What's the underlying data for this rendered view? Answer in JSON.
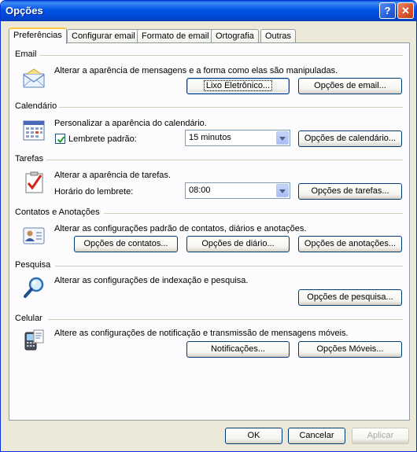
{
  "window": {
    "title": "Opções",
    "help_glyph": "?",
    "close_glyph": "✕"
  },
  "tabs": [
    {
      "label": "Preferências",
      "active": true
    },
    {
      "label": "Configurar email"
    },
    {
      "label": "Formato de email"
    },
    {
      "label": "Ortografia"
    },
    {
      "label": "Outras"
    }
  ],
  "email": {
    "section": "Email",
    "description": "Alterar a aparência de mensagens e a forma como elas são manipuladas.",
    "junk_button": "Lixo Eletrônico...",
    "options_button": "Opções de email..."
  },
  "calendar": {
    "section": "Calendário",
    "description": "Personalizar a aparência do calendário.",
    "reminder_label": "Lembrete padrão:",
    "reminder_checked": true,
    "reminder_value": "15 minutos",
    "options_button": "Opções de calendário..."
  },
  "tasks": {
    "section": "Tarefas",
    "description": "Alterar a aparência de tarefas.",
    "reminder_time_label": "Horário do lembrete:",
    "reminder_time_value": "08:00",
    "options_button": "Opções de tarefas..."
  },
  "contacts": {
    "section": "Contatos e Anotações",
    "description": "Alterar as configurações padrão de contatos, diários e anotações.",
    "contacts_button": "Opções de contatos...",
    "journal_button": "Opções de diário...",
    "notes_button": "Opções de anotações..."
  },
  "search": {
    "section": "Pesquisa",
    "description": "Alterar as configurações de indexação e pesquisa.",
    "options_button": "Opções de pesquisa..."
  },
  "mobile": {
    "section": "Celular",
    "description": "Altere as configurações de notificação e transmissão de mensagens móveis.",
    "notifications_button": "Notificações...",
    "mobile_button": "Opções Móveis..."
  },
  "footer": {
    "ok": "OK",
    "cancel": "Cancelar",
    "apply": "Aplicar",
    "apply_enabled": false
  },
  "colors": {
    "titlebar": "#0054e3",
    "dialog_bg": "#ece9d8",
    "panel_bg": "#fcfcfe",
    "tab_highlight": "#ffc83c"
  },
  "icons": {
    "email": "envelope-icon",
    "calendar": "calendar-icon",
    "tasks": "task-check-icon",
    "contacts": "contact-card-icon",
    "search": "magnifier-icon",
    "mobile": "mobile-device-icon"
  }
}
